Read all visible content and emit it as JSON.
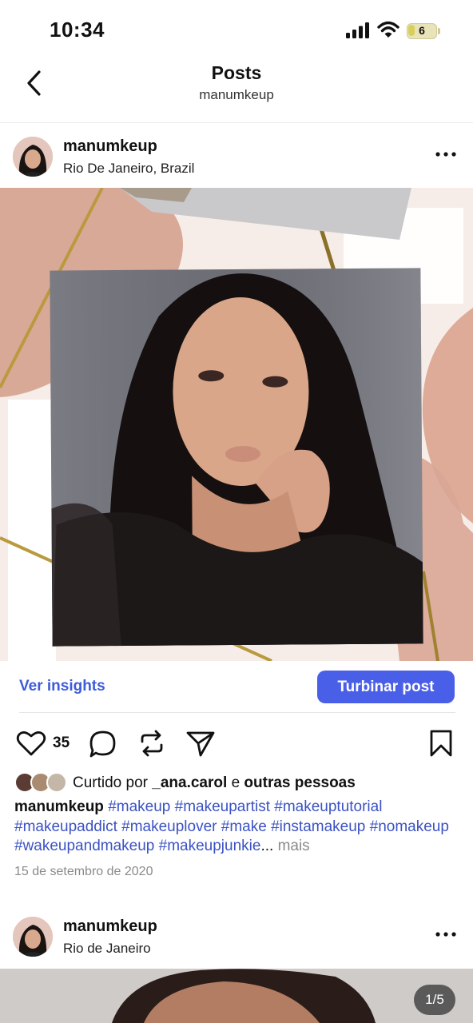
{
  "status_bar": {
    "time": "10:34",
    "battery_level": "6"
  },
  "header": {
    "title": "Posts",
    "subtitle": "manumkeup"
  },
  "post1": {
    "username": "manumkeup",
    "location": "Rio De Janeiro, Brazil",
    "insights_label": "Ver insights",
    "boost_label": "Turbinar post",
    "like_count": "35",
    "liked_prefix": "Curtido por",
    "liked_user": "_ana.carol",
    "liked_conj": "e",
    "liked_others": "outras pessoas",
    "caption_user": "manumkeup",
    "caption_hashtags": "#makeup #makeupartist #makeuptutorial #makeupaddict #makeuplover #make #instamakeup #nomakeup #wakeupandmakeup #makeupjunkie",
    "caption_ellipsis": "...",
    "more_label": "mais",
    "date": "15 de setembro de 2020"
  },
  "post2": {
    "username": "manumkeup",
    "location": "Rio de Janeiro",
    "image_counter": "1/5"
  },
  "colors": {
    "accent": "#4a5fe8",
    "link": "#3e5bd8",
    "hashtag": "#3b52c4"
  }
}
